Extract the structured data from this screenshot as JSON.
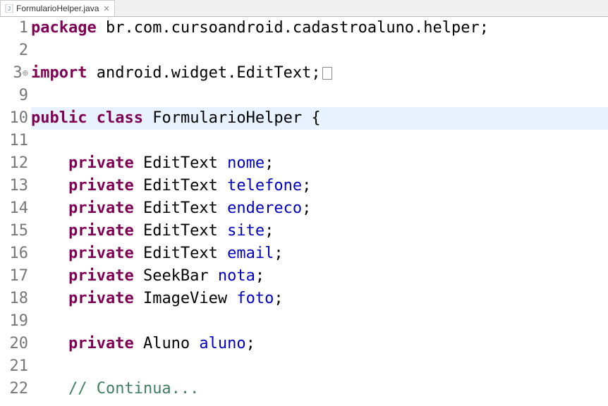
{
  "tab": {
    "filename": "FormularioHelper.java",
    "close": "✕"
  },
  "lines": {
    "ln1": "1",
    "ln2": "2",
    "ln3": "3",
    "ln9": "9",
    "ln10": "10",
    "ln11": "11",
    "ln12": "12",
    "ln13": "13",
    "ln14": "14",
    "ln15": "15",
    "ln16": "16",
    "ln17": "17",
    "ln18": "18",
    "ln19": "19",
    "ln20": "20",
    "ln21": "21",
    "ln22": "22"
  },
  "code": {
    "kw_package": "package",
    "pkg_name": " br.com.cursoandroid.cadastroaluno.helper;",
    "kw_import": "import",
    "import_name": " android.widget.EditText;",
    "kw_public": "public",
    "kw_class": "class",
    "class_name": " FormularioHelper {",
    "kw_private": "private",
    "type_edittext": " EditText ",
    "type_seekbar": " SeekBar ",
    "type_imageview": " ImageView ",
    "type_aluno": " Aluno ",
    "f_nome": "nome",
    "f_telefone": "telefone",
    "f_endereco": "endereco",
    "f_site": "site",
    "f_email": "email",
    "f_nota": "nota",
    "f_foto": "foto",
    "f_aluno": "aluno",
    "semi": ";",
    "space": " ",
    "indent": "    ",
    "comment_continua": "// Continua..."
  }
}
